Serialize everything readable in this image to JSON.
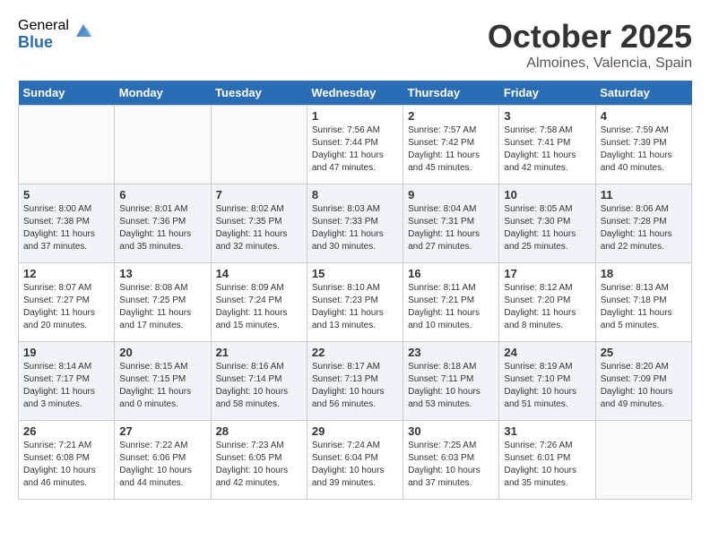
{
  "logo": {
    "general": "General",
    "blue": "Blue"
  },
  "title": "October 2025",
  "location": "Almoines, Valencia, Spain",
  "weekdays": [
    "Sunday",
    "Monday",
    "Tuesday",
    "Wednesday",
    "Thursday",
    "Friday",
    "Saturday"
  ],
  "weeks": [
    [
      {
        "day": "",
        "info": ""
      },
      {
        "day": "",
        "info": ""
      },
      {
        "day": "",
        "info": ""
      },
      {
        "day": "1",
        "info": "Sunrise: 7:56 AM\nSunset: 7:44 PM\nDaylight: 11 hours\nand 47 minutes."
      },
      {
        "day": "2",
        "info": "Sunrise: 7:57 AM\nSunset: 7:42 PM\nDaylight: 11 hours\nand 45 minutes."
      },
      {
        "day": "3",
        "info": "Sunrise: 7:58 AM\nSunset: 7:41 PM\nDaylight: 11 hours\nand 42 minutes."
      },
      {
        "day": "4",
        "info": "Sunrise: 7:59 AM\nSunset: 7:39 PM\nDaylight: 11 hours\nand 40 minutes."
      }
    ],
    [
      {
        "day": "5",
        "info": "Sunrise: 8:00 AM\nSunset: 7:38 PM\nDaylight: 11 hours\nand 37 minutes."
      },
      {
        "day": "6",
        "info": "Sunrise: 8:01 AM\nSunset: 7:36 PM\nDaylight: 11 hours\nand 35 minutes."
      },
      {
        "day": "7",
        "info": "Sunrise: 8:02 AM\nSunset: 7:35 PM\nDaylight: 11 hours\nand 32 minutes."
      },
      {
        "day": "8",
        "info": "Sunrise: 8:03 AM\nSunset: 7:33 PM\nDaylight: 11 hours\nand 30 minutes."
      },
      {
        "day": "9",
        "info": "Sunrise: 8:04 AM\nSunset: 7:31 PM\nDaylight: 11 hours\nand 27 minutes."
      },
      {
        "day": "10",
        "info": "Sunrise: 8:05 AM\nSunset: 7:30 PM\nDaylight: 11 hours\nand 25 minutes."
      },
      {
        "day": "11",
        "info": "Sunrise: 8:06 AM\nSunset: 7:28 PM\nDaylight: 11 hours\nand 22 minutes."
      }
    ],
    [
      {
        "day": "12",
        "info": "Sunrise: 8:07 AM\nSunset: 7:27 PM\nDaylight: 11 hours\nand 20 minutes."
      },
      {
        "day": "13",
        "info": "Sunrise: 8:08 AM\nSunset: 7:25 PM\nDaylight: 11 hours\nand 17 minutes."
      },
      {
        "day": "14",
        "info": "Sunrise: 8:09 AM\nSunset: 7:24 PM\nDaylight: 11 hours\nand 15 minutes."
      },
      {
        "day": "15",
        "info": "Sunrise: 8:10 AM\nSunset: 7:23 PM\nDaylight: 11 hours\nand 13 minutes."
      },
      {
        "day": "16",
        "info": "Sunrise: 8:11 AM\nSunset: 7:21 PM\nDaylight: 11 hours\nand 10 minutes."
      },
      {
        "day": "17",
        "info": "Sunrise: 8:12 AM\nSunset: 7:20 PM\nDaylight: 11 hours\nand 8 minutes."
      },
      {
        "day": "18",
        "info": "Sunrise: 8:13 AM\nSunset: 7:18 PM\nDaylight: 11 hours\nand 5 minutes."
      }
    ],
    [
      {
        "day": "19",
        "info": "Sunrise: 8:14 AM\nSunset: 7:17 PM\nDaylight: 11 hours\nand 3 minutes."
      },
      {
        "day": "20",
        "info": "Sunrise: 8:15 AM\nSunset: 7:15 PM\nDaylight: 11 hours\nand 0 minutes."
      },
      {
        "day": "21",
        "info": "Sunrise: 8:16 AM\nSunset: 7:14 PM\nDaylight: 10 hours\nand 58 minutes."
      },
      {
        "day": "22",
        "info": "Sunrise: 8:17 AM\nSunset: 7:13 PM\nDaylight: 10 hours\nand 56 minutes."
      },
      {
        "day": "23",
        "info": "Sunrise: 8:18 AM\nSunset: 7:11 PM\nDaylight: 10 hours\nand 53 minutes."
      },
      {
        "day": "24",
        "info": "Sunrise: 8:19 AM\nSunset: 7:10 PM\nDaylight: 10 hours\nand 51 minutes."
      },
      {
        "day": "25",
        "info": "Sunrise: 8:20 AM\nSunset: 7:09 PM\nDaylight: 10 hours\nand 49 minutes."
      }
    ],
    [
      {
        "day": "26",
        "info": "Sunrise: 7:21 AM\nSunset: 6:08 PM\nDaylight: 10 hours\nand 46 minutes."
      },
      {
        "day": "27",
        "info": "Sunrise: 7:22 AM\nSunset: 6:06 PM\nDaylight: 10 hours\nand 44 minutes."
      },
      {
        "day": "28",
        "info": "Sunrise: 7:23 AM\nSunset: 6:05 PM\nDaylight: 10 hours\nand 42 minutes."
      },
      {
        "day": "29",
        "info": "Sunrise: 7:24 AM\nSunset: 6:04 PM\nDaylight: 10 hours\nand 39 minutes."
      },
      {
        "day": "30",
        "info": "Sunrise: 7:25 AM\nSunset: 6:03 PM\nDaylight: 10 hours\nand 37 minutes."
      },
      {
        "day": "31",
        "info": "Sunrise: 7:26 AM\nSunset: 6:01 PM\nDaylight: 10 hours\nand 35 minutes."
      },
      {
        "day": "",
        "info": ""
      }
    ]
  ]
}
